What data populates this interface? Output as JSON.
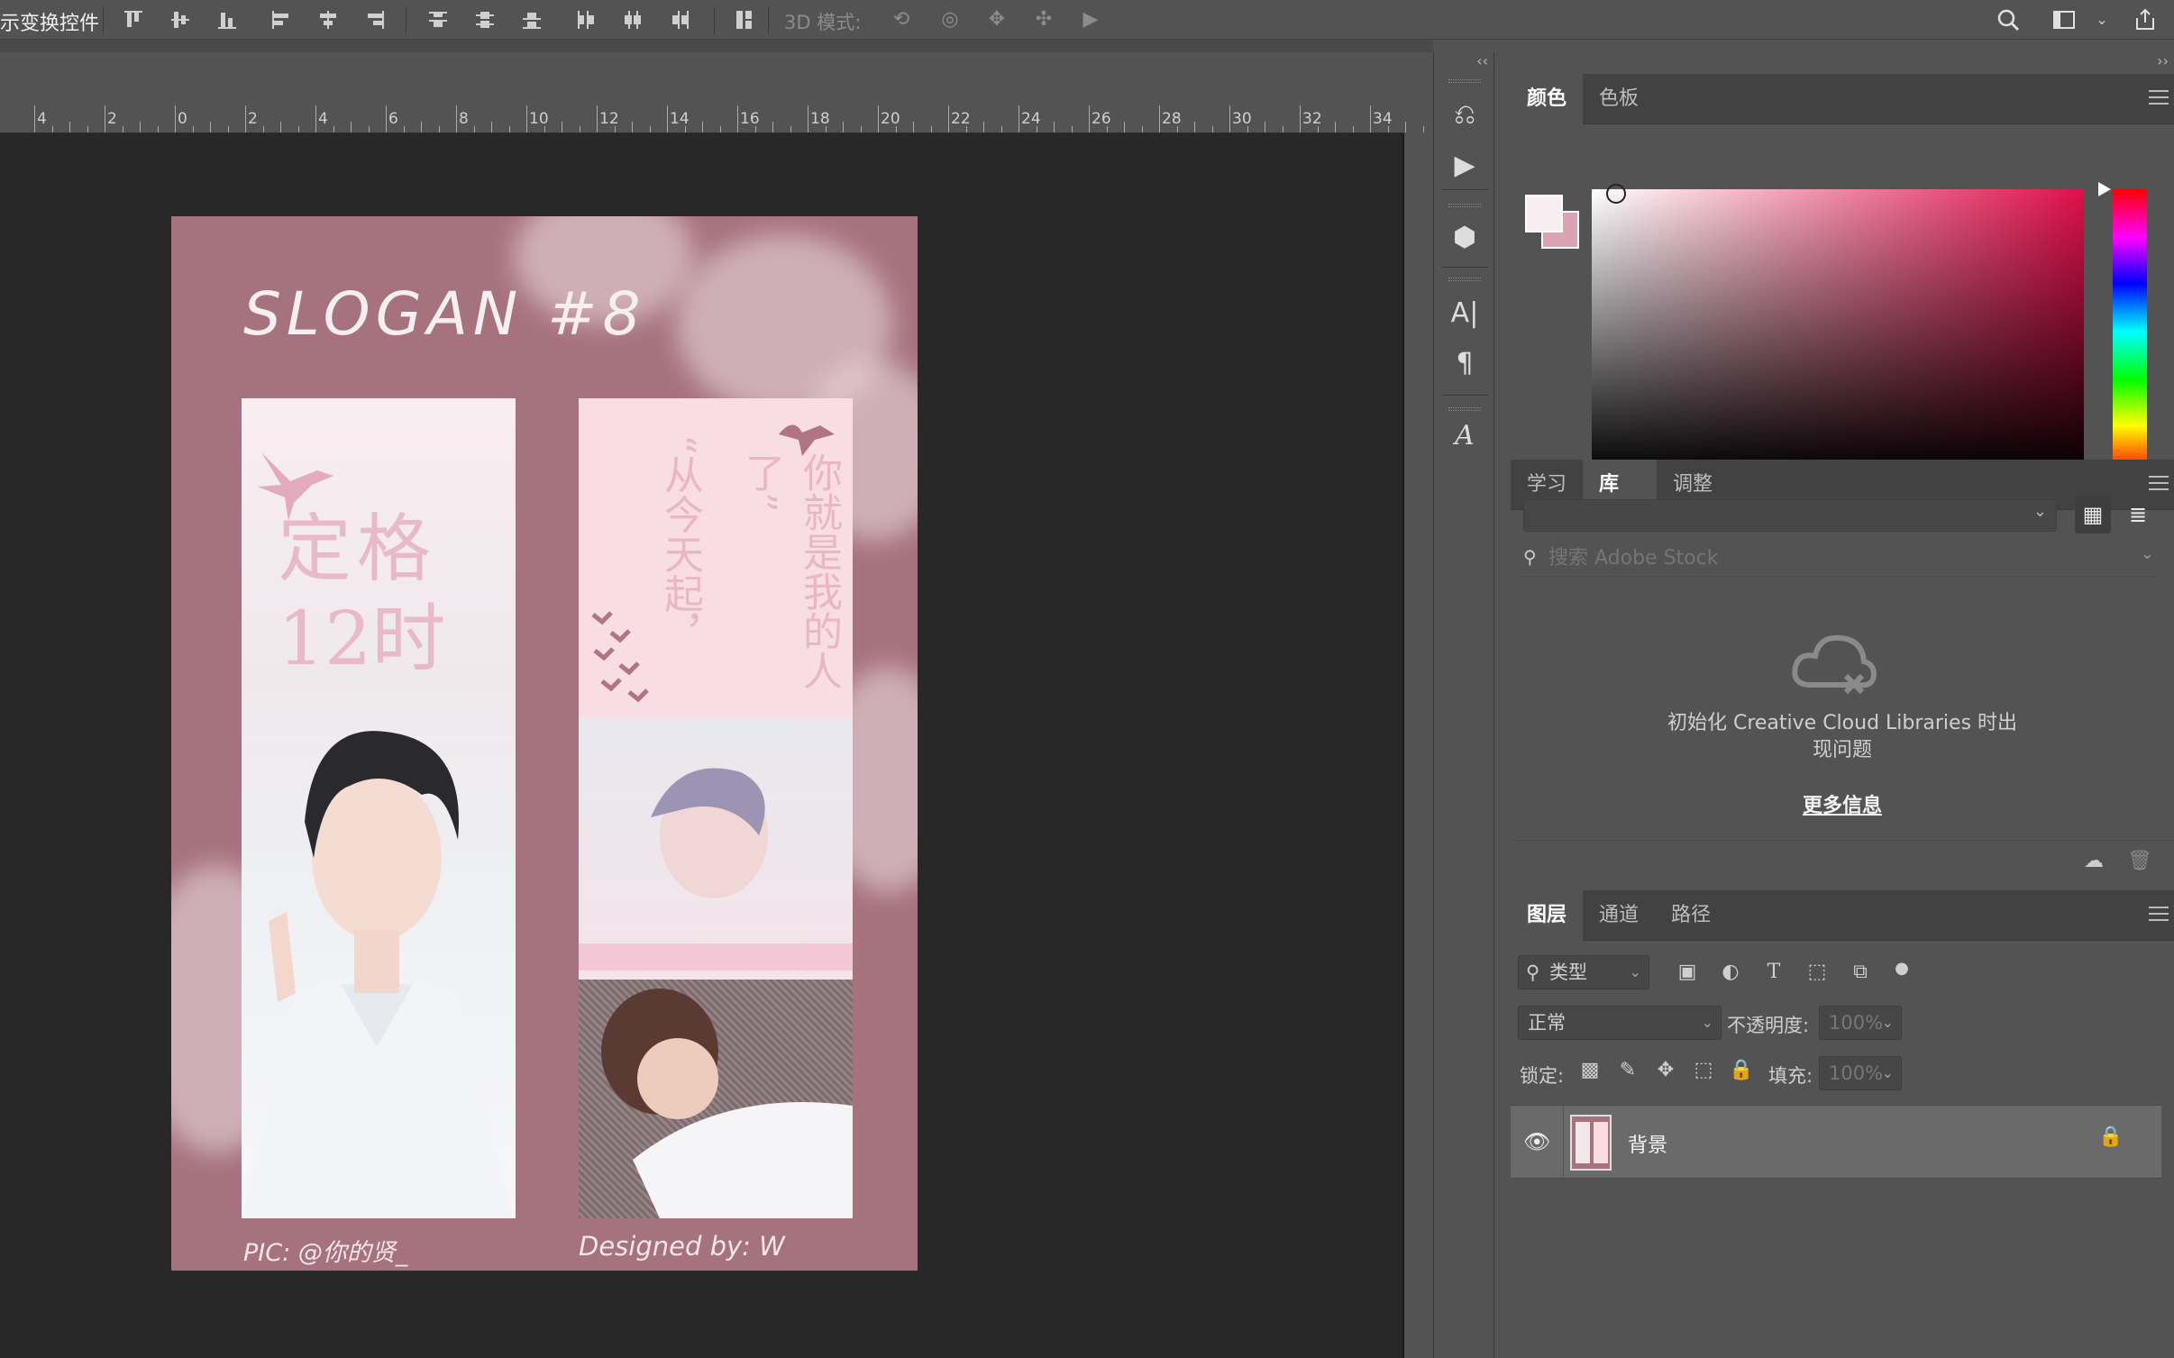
{
  "options_bar": {
    "transform_label": "示变换控件",
    "mode_3d_label": "3D 模式:",
    "align_icons": [
      "align-top-icon",
      "align-vcenter-icon",
      "align-bottom-icon",
      "align-left-icon",
      "align-hcenter-icon",
      "align-right-icon",
      "distribute-top-icon",
      "distribute-vcenter-icon",
      "distribute-bottom-icon",
      "distribute-left-icon",
      "distribute-hcenter-icon",
      "distribute-right-icon",
      "auto-align-icon"
    ]
  },
  "ruler": {
    "labels": [
      "4",
      "2",
      "0",
      "2",
      "4",
      "6",
      "8",
      "10",
      "12",
      "14",
      "16",
      "18",
      "20",
      "22",
      "24",
      "26",
      "28",
      "30",
      "32",
      "34"
    ]
  },
  "document": {
    "title": "SLOGAN #8",
    "left_vertical_line1": "定格",
    "left_vertical_line2": "12时",
    "right_vertical_line1": "“从今天起，",
    "right_vertical_line2": "你就是我的人了”",
    "credit_left": "PIC: @你的贤_",
    "credit_right": "Designed by: W",
    "background_color": "#a6727e"
  },
  "color_panel": {
    "tabs": [
      "颜色",
      "色板"
    ],
    "active_tab": "颜色",
    "foreground_color": "#f8eef1",
    "background_color": "#d9a3b1",
    "hue_color": "#e0104a"
  },
  "library_panel": {
    "tabs": [
      "学习",
      "库",
      "调整"
    ],
    "active_tab": "库",
    "search_placeholder": "搜索 Adobe Stock",
    "message_line1": "初始化 Creative Cloud Libraries 时出",
    "message_line2": "现问题",
    "more_info_link": "更多信息"
  },
  "layers_panel": {
    "tabs": [
      "图层",
      "通道",
      "路径"
    ],
    "active_tab": "图层",
    "filter_label": "类型",
    "blend_mode": "正常",
    "opacity_label": "不透明度:",
    "opacity_value": "100%",
    "lock_label": "锁定:",
    "fill_label": "填充:",
    "fill_value": "100%",
    "layers": [
      {
        "name": "背景",
        "visible": true,
        "locked": true
      }
    ]
  }
}
